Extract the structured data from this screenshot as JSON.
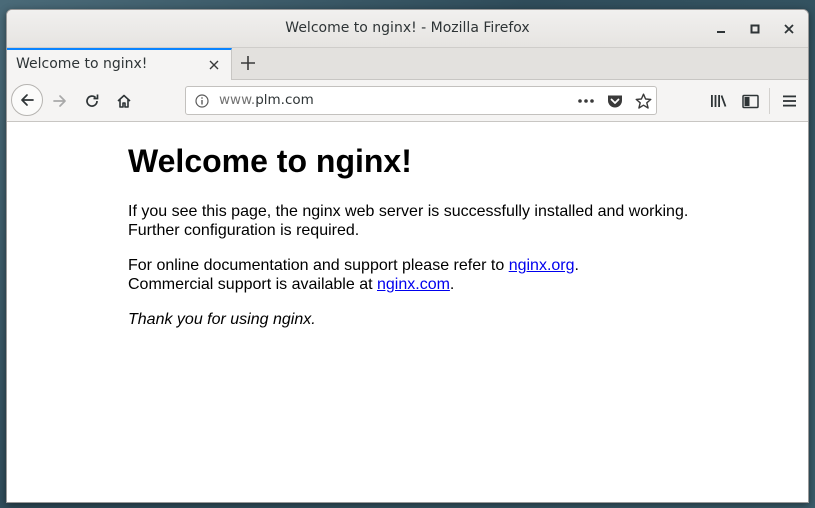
{
  "window": {
    "title": "Welcome to nginx! - Mozilla Firefox"
  },
  "tabs": [
    {
      "label": "Welcome to nginx!",
      "active": true
    }
  ],
  "urlbar": {
    "prefix": "www.",
    "domain": "plm.com"
  },
  "page": {
    "heading": "Welcome to nginx!",
    "p1_line1": "If you see this page, the nginx web server is successfully installed and working.",
    "p1_line2": "Further configuration is required.",
    "p2_line1_text": "For online documentation and support please refer to ",
    "p2_link1": "nginx.org",
    "p2_line1_end": ".",
    "p2_line2_text": "Commercial support is available at ",
    "p2_link2": "nginx.com",
    "p2_line2_end": ".",
    "p3": "Thank you for using nginx."
  },
  "colors": {
    "accent": "#0a84ff",
    "link": "#0000ee"
  },
  "icons": [
    "minimize-icon",
    "maximize-icon",
    "close-icon",
    "tab-close-icon",
    "plus-icon",
    "back-arrow-icon",
    "forward-arrow-icon",
    "reload-icon",
    "home-icon",
    "info-icon",
    "more-icon",
    "pocket-icon",
    "star-icon",
    "library-icon",
    "sidebar-icon",
    "hamburger-menu-icon"
  ]
}
